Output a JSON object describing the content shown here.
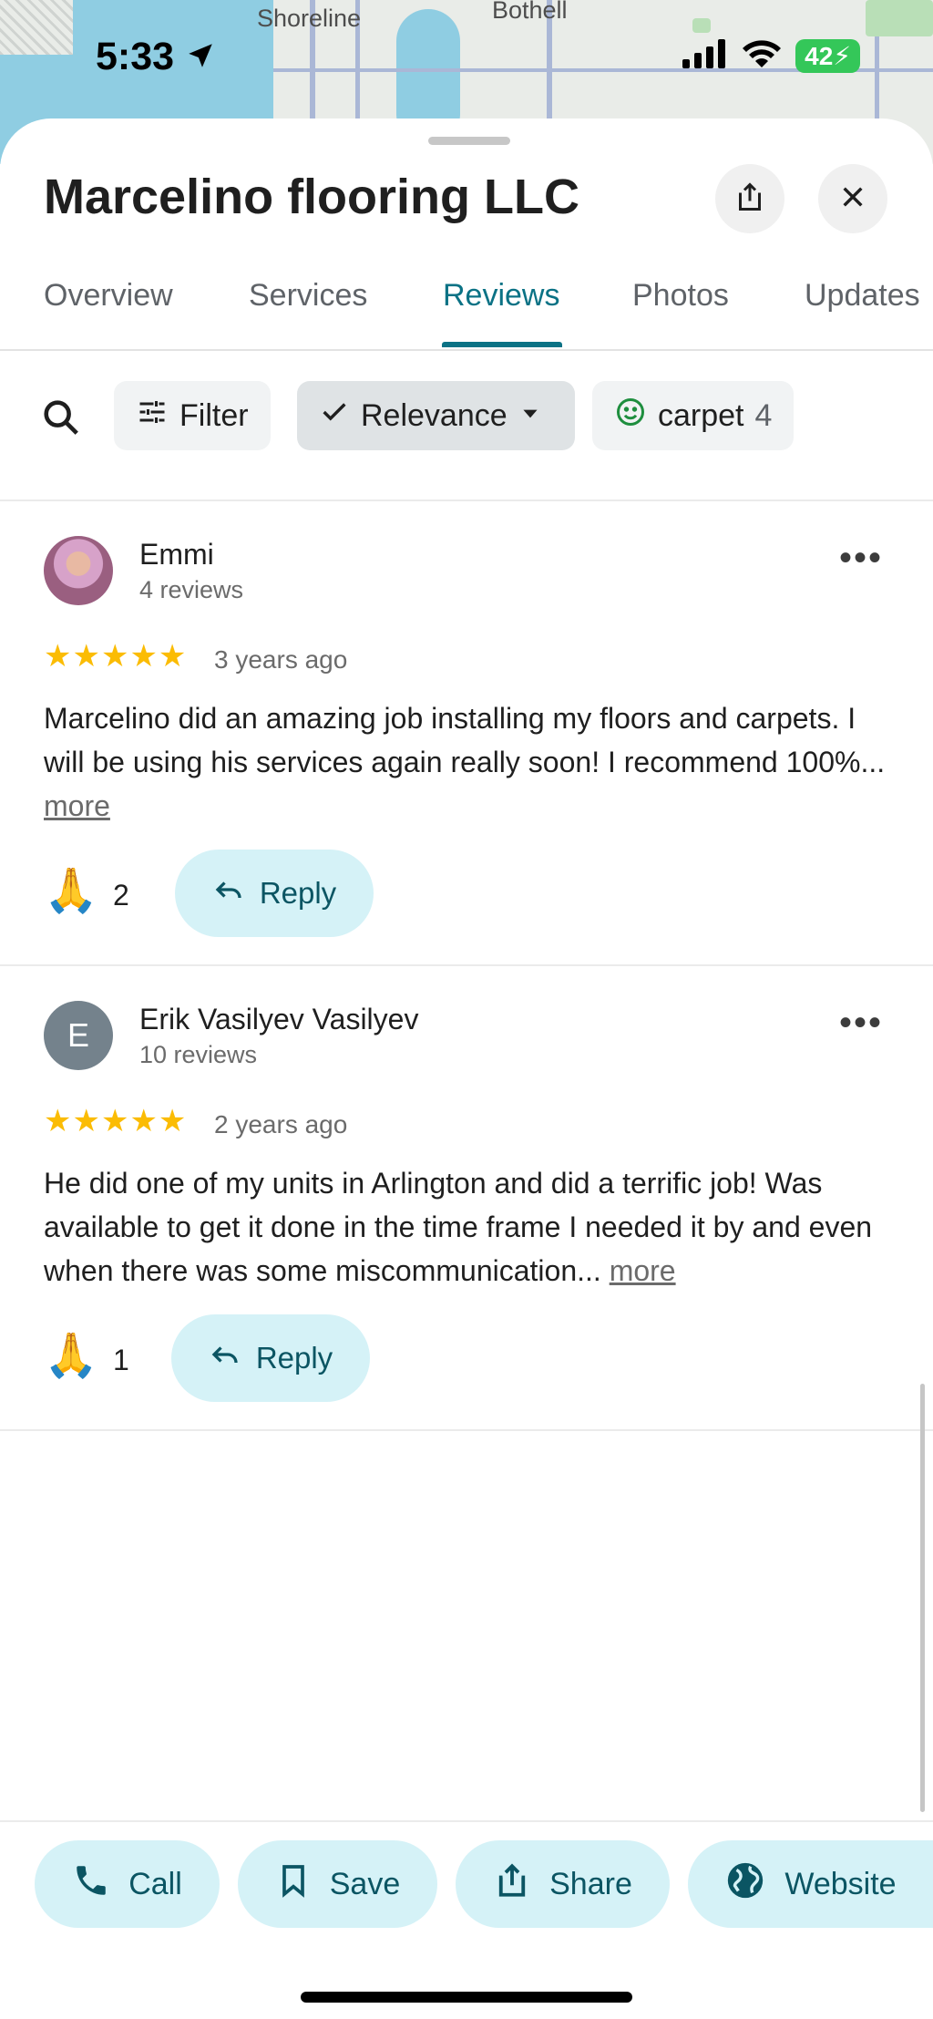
{
  "map": {
    "labels": [
      "Shoreline",
      "Bothell"
    ]
  },
  "status_bar": {
    "time": "5:33",
    "battery": "42"
  },
  "place": {
    "title": "Marcelino flooring LLC"
  },
  "tabs": [
    {
      "label": "Overview",
      "active": false
    },
    {
      "label": "Services",
      "active": false
    },
    {
      "label": "Reviews",
      "active": true
    },
    {
      "label": "Photos",
      "active": false
    },
    {
      "label": "Updates",
      "active": false
    }
  ],
  "filters": {
    "filter_label": "Filter",
    "sort_label": "Relevance",
    "topic_label": "carpet",
    "topic_count": "4"
  },
  "reviews": [
    {
      "author": "Emmi",
      "author_sub": "4 reviews",
      "stars": "★★★★★",
      "rating": 5,
      "time": "3 years ago",
      "text": "Marcelino did an amazing job installing my floors and carpets. I will be using his services again really soon!  I recommend 100%...",
      "more": "more",
      "likes": "2",
      "reply_label": "Reply"
    },
    {
      "author": "Erik Vasilyev Vasilyev",
      "author_initial": "E",
      "author_sub": "10 reviews",
      "stars": "★★★★★",
      "rating": 5,
      "time": "2 years ago",
      "text": "He did one of my units in Arlington and did a terrific job! Was available to get it done in the time frame I needed it by and even when there was some miscommunication...",
      "more": "more",
      "likes": "1",
      "reply_label": "Reply"
    }
  ],
  "actions": {
    "call": "Call",
    "save": "Save",
    "share": "Share",
    "website": "Website"
  },
  "colors": {
    "accent": "#0b7285",
    "chip_bg": "#d5f2f7",
    "star": "#fbbc04"
  }
}
